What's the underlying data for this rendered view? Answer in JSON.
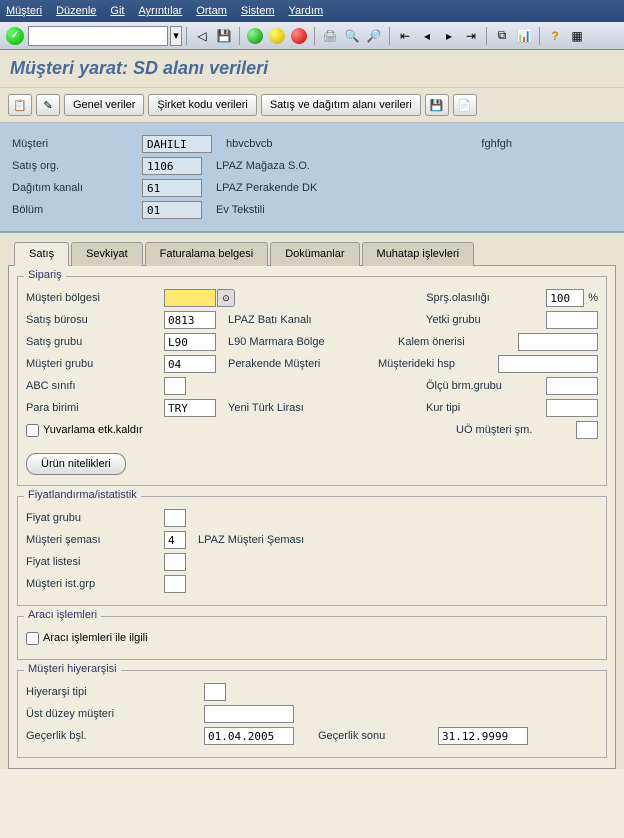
{
  "menu": {
    "m1": "Müşteri",
    "m2": "Düzenle",
    "m3": "Git",
    "m4": "Ayrıntılar",
    "m5": "Ortam",
    "m6": "Sistem",
    "m7": "Yardım"
  },
  "page_title": "Müşteri yarat: SD alanı verileri",
  "appbar": {
    "genel": "Genel veriler",
    "sirket": "Şirket kodu verileri",
    "satis": "Satış ve dağıtım alanı verileri"
  },
  "header": {
    "musteri_lbl": "Müşteri",
    "musteri_val": "DAHILI",
    "musteri_desc": "hbvcbvcb",
    "musteri_extra": "fghfgh",
    "satisorg_lbl": "Satış org.",
    "satisorg_val": "1106",
    "satisorg_desc": "LPAZ Mağaza S.O.",
    "dagitim_lbl": "Dağıtım kanalı",
    "dagitim_val": "61",
    "dagitim_desc": "LPAZ Perakende DK",
    "bolum_lbl": "Bölüm",
    "bolum_val": "01",
    "bolum_desc": "Ev Tekstili"
  },
  "tabs": {
    "t1": "Satış",
    "t2": "Sevkiyat",
    "t3": "Faturalama belgesi",
    "t4": "Dokümanlar",
    "t5": "Muhatap işlevleri"
  },
  "siparis": {
    "title": "Sipariş",
    "bolge_lbl": "Müşteri bölgesi",
    "bolge_val": "",
    "buro_lbl": "Satış bürosu",
    "buro_val": "0813",
    "buro_desc": "LPAZ Batı Kanalı",
    "grub_lbl": "Satış grubu",
    "grub_val": "L90",
    "grub_desc": "L90 Marmara Bölge",
    "mgrub_lbl": "Müşteri grubu",
    "mgrub_val": "04",
    "mgrub_desc": "Perakende Müşteri",
    "abc_lbl": "ABC sınıfı",
    "abc_val": "",
    "para_lbl": "Para birimi",
    "para_val": "TRY",
    "para_desc": "Yeni Türk Lirası",
    "yuv_lbl": "Yuvarlama etk.kaldır",
    "olasilik_lbl": "Sprş.olasılığı",
    "olasilik_val": "100",
    "pct": "%",
    "yetki_lbl": "Yetki grubu",
    "yetki_val": "",
    "kalem_lbl": "Kalem önerisi",
    "kalem_val": "",
    "hsp_lbl": "Müşterideki hsp",
    "hsp_val": "",
    "olcu_lbl": "Ölçü brm.grubu",
    "olcu_val": "",
    "kur_lbl": "Kur tipi",
    "kur_val": "",
    "uo_lbl": "UÖ müşteri şm.",
    "uo_val": "",
    "urun_btn": "Ürün nitelikleri"
  },
  "fiyat": {
    "title": "Fiyatlandırma/istatistik",
    "fiyatgrub_lbl": "Fiyat grubu",
    "fiyatgrub_val": "",
    "sema_lbl": "Müşteri şeması",
    "sema_val": "4",
    "sema_desc": "LPAZ Müşteri Şeması",
    "liste_lbl": "Fiyat listesi",
    "liste_val": "",
    "istgrp_lbl": "Müşteri ist.grp",
    "istgrp_val": ""
  },
  "araci": {
    "title": "Aracı işlemleri",
    "ilgili_lbl": "Aracı işlemleri ile ilgili"
  },
  "hiyer": {
    "title": "Müşteri hiyerarşisi",
    "tip_lbl": "Hiyerarşi tipi",
    "tip_val": "",
    "ust_lbl": "Üst düzey müşteri",
    "ust_val": "",
    "bsl_lbl": "Geçerlik bşl.",
    "bsl_val": "01.04.2005",
    "son_lbl": "Geçerlik sonu",
    "son_val": "31.12.9999"
  }
}
